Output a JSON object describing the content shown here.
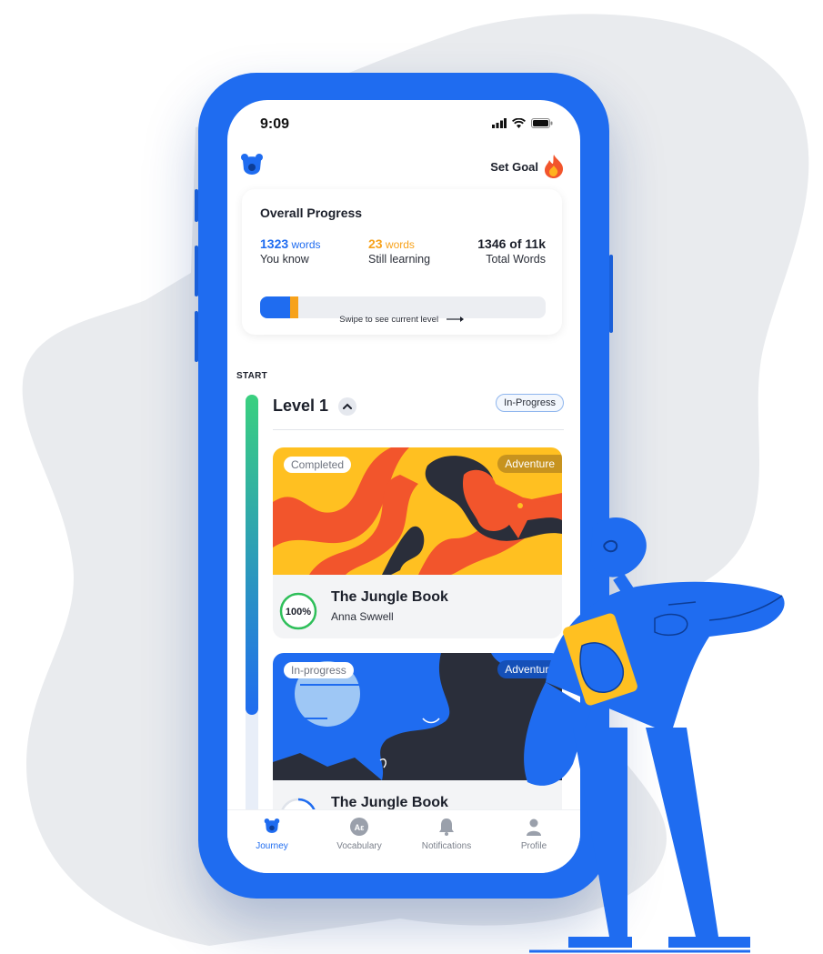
{
  "status_bar": {
    "time": "9:09"
  },
  "header": {
    "set_goal_label": "Set Goal"
  },
  "overall_progress": {
    "title": "Overall Progress",
    "known": {
      "count": "1323",
      "unit": "words",
      "label": "You know"
    },
    "learning": {
      "count": "23",
      "unit": "words",
      "label": "Still learning"
    },
    "total": {
      "count": "1346 of 11k",
      "label": "Total Words"
    },
    "known_fraction": 0.106,
    "learning_fraction": 0.028,
    "swipe_hint": "Swipe to see current level"
  },
  "journey": {
    "start_label": "START",
    "track_progress_fraction": 0.67,
    "level": {
      "title": "Level 1",
      "status": "In-Progress"
    },
    "books": [
      {
        "status": "Completed",
        "genre": "Adventure",
        "title": "The Jungle Book",
        "author": "Anna Swwell",
        "progress_label": "100%",
        "progress": 1.0
      },
      {
        "status": "In-progress",
        "genre": "Adventure",
        "title": "The Jungle Book",
        "progress": 0.3
      }
    ]
  },
  "bottom_nav": [
    {
      "label": "Journey",
      "icon": "bear-icon",
      "active": true
    },
    {
      "label": "Vocabulary",
      "icon": "translate-icon",
      "active": false
    },
    {
      "label": "Notifications",
      "icon": "bell-icon",
      "active": false
    },
    {
      "label": "Profile",
      "icon": "user-icon",
      "active": false
    }
  ],
  "colors": {
    "primary": "#1f6cf0",
    "accent": "#f7a21b",
    "success": "#2fbf5a",
    "text": "#1b1f2a"
  }
}
